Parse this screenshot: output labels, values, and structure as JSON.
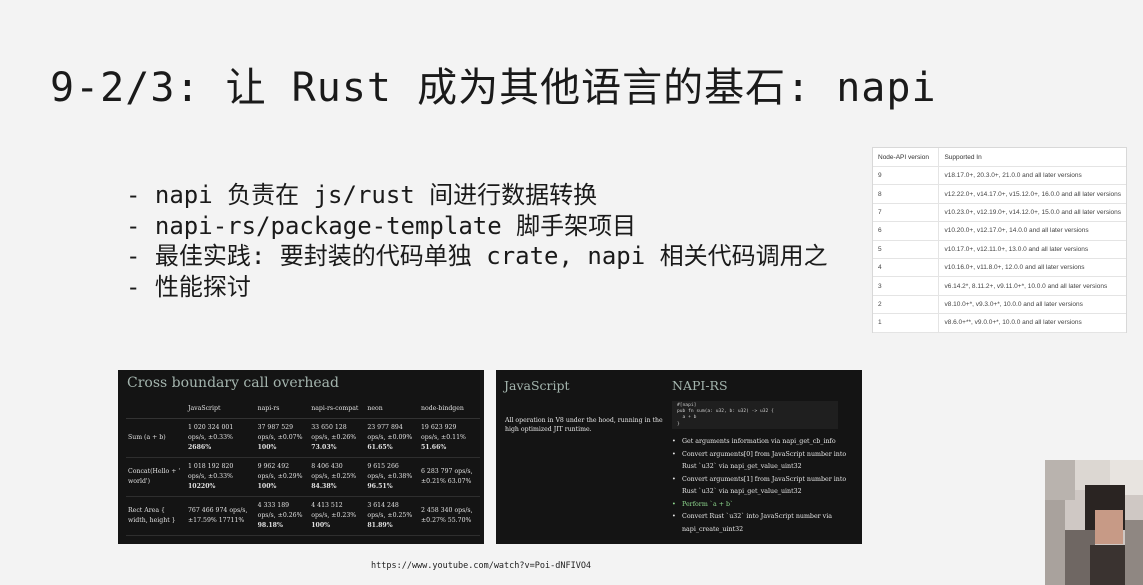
{
  "slide": {
    "title": "9-2/3: 让 Rust 成为其他语言的基石: napi",
    "bullets": [
      "- napi 负责在 js/rust 间进行数据转换",
      "- napi-rs/package-template 脚手架项目",
      "- 最佳实践: 要封装的代码单独 crate, napi 相关代码调用之",
      "- 性能探讨"
    ],
    "url": "https://www.youtube.com/watch?v=Poi-dNFIVO4"
  },
  "node_api_table": {
    "headers": [
      "Node-API version",
      "Supported In"
    ],
    "rows": [
      [
        "9",
        "v18.17.0+, 20.3.0+, 21.0.0 and all later versions"
      ],
      [
        "8",
        "v12.22.0+, v14.17.0+, v15.12.0+, 16.0.0 and all later versions"
      ],
      [
        "7",
        "v10.23.0+, v12.19.0+, v14.12.0+, 15.0.0 and all later versions"
      ],
      [
        "6",
        "v10.20.0+, v12.17.0+, 14.0.0 and all later versions"
      ],
      [
        "5",
        "v10.17.0+, v12.11.0+, 13.0.0 and all later versions"
      ],
      [
        "4",
        "v10.16.0+, v11.8.0+, 12.0.0 and all later versions"
      ],
      [
        "3",
        "v6.14.2*, 8.11.2+, v9.11.0+*, 10.0.0 and all later versions"
      ],
      [
        "2",
        "v8.10.0+*, v9.3.0+*, 10.0.0 and all later versions"
      ],
      [
        "1",
        "v8.6.0+**, v9.0.0+*, 10.0.0 and all later versions"
      ]
    ]
  },
  "call_overhead": {
    "title": "Cross boundary call overhead",
    "headers": [
      "",
      "JavaScript",
      "napi-rs",
      "napi-rs-compat",
      "neon",
      "node-bindgen"
    ],
    "rows": [
      {
        "label": "Sum (a + b)",
        "cells": [
          [
            "1 020 324 001",
            "ops/s, ±0.33%",
            "2686%"
          ],
          [
            "37 987 529",
            "ops/s, ±0.07%",
            "100%"
          ],
          [
            "33 650 128",
            "ops/s, ±0.26%",
            "73.03%"
          ],
          [
            "23 977 894",
            "ops/s, ±0.09%",
            "61.65%"
          ],
          [
            "19 623 929",
            "ops/s, ±0.11%",
            "51.66%"
          ]
        ]
      },
      {
        "label": "Concat(Hello + ' world')",
        "cells": [
          [
            "1 018 192 820",
            "ops/s, ±0.33%",
            "10220%"
          ],
          [
            "9 962 492",
            "ops/s, ±0.29%",
            "100%"
          ],
          [
            "8 406 430",
            "ops/s, ±0.25%",
            "84.38%"
          ],
          [
            "9 615 266",
            "ops/s, ±0.38%",
            "96.51%"
          ],
          [
            "6 283 797 ops/s,",
            "±0.21% 63.07%",
            ""
          ]
        ]
      },
      {
        "label": "Rect Area { width, height }",
        "cells": [
          [
            "767 466 974 ops/s,",
            "±17.59% 17711%",
            ""
          ],
          [
            "4 333 189",
            "ops/s, ±0.26%",
            "98.18%"
          ],
          [
            "4 413 512",
            "ops/s, ±0.23%",
            "100%"
          ],
          [
            "3 614 248",
            "ops/s, ±0.25%",
            "81.89%"
          ],
          [
            "2 458 340 ops/s,",
            "±0.27% 55.70%",
            ""
          ]
        ]
      }
    ]
  },
  "js_vs_napi": {
    "left_title": "JavaScript",
    "right_title": "NAPI-RS",
    "left_desc": "All operation in V8 under the hood, running in the high optimized JIT runtime.",
    "code": "#[napi]\npub fn sum(a: u32, b: u32) -> u32 {\n  a + b\n}",
    "steps": [
      "Get arguments information via napi_get_cb_info",
      "Convert arguments[0] from JavaScript number into",
      "Rust `u32` via napi_get_value_uint32",
      "Convert arguments[1] from JavaScript number into",
      "Rust `u32` via napi_get_value_uint32",
      "Perform `a + b`",
      "Convert Rust `u32` into JavaScript number via",
      "napi_create_uint32"
    ]
  }
}
